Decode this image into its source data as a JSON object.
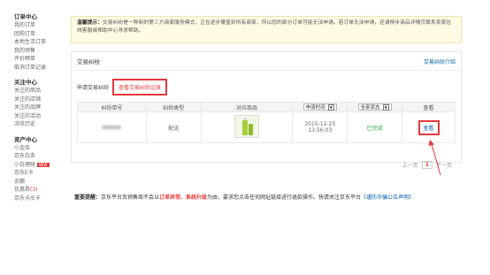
{
  "sidebar": {
    "groups": [
      {
        "title": "订单中心",
        "items": [
          {
            "label": "我的订单"
          },
          {
            "label": "团购订单"
          },
          {
            "label": "本地生活订单"
          },
          {
            "label": "我的预售"
          },
          {
            "label": "评价晒单"
          },
          {
            "label": "取消订单记录"
          }
        ]
      },
      {
        "title": "关注中心",
        "items": [
          {
            "label": "关注的商品"
          },
          {
            "label": "关注的店铺"
          },
          {
            "label": "关注的品牌"
          },
          {
            "label": "关注的活动"
          },
          {
            "label": "浏览历史"
          }
        ]
      },
      {
        "title": "资产中心",
        "items": [
          {
            "label": "小金库"
          },
          {
            "label": "京东白条"
          },
          {
            "label": "小白理财",
            "badge": "NEW"
          },
          {
            "label": "京东E卡"
          },
          {
            "label": "余额"
          },
          {
            "label": "优惠券",
            "count": "(3)"
          },
          {
            "label": "京东卡/E卡"
          }
        ]
      }
    ]
  },
  "notice": {
    "label": "温馨提示：",
    "text": "交易纠纷是一种新的第三方商家服务模式，正在逐步覆盖到所有商家，所以您的部分订单可能无法申请。若订单无法申请，还请移步商品详情页联系卖家在线客服或帮助中心寻求帮助。"
  },
  "panel": {
    "title": "交易纠纷",
    "intro_link": "交易纠纷介绍",
    "tab_apply": "申请交易纠纷",
    "tab_records": "查看交易纠纷记录"
  },
  "table": {
    "headers": [
      "纠纷单号",
      "纠纷类型",
      "对应商品"
    ],
    "time_filter": "申请时间",
    "status_filter": "全部状态",
    "view_header": "查看",
    "rows": [
      {
        "type": "配送",
        "date": "2015-12-15",
        "time": "13:56:03",
        "status": "已完成",
        "action": "查看"
      }
    ]
  },
  "pager": {
    "prev": "上一页",
    "current": "1",
    "next": "下一页"
  },
  "important": {
    "label": "重要提醒：",
    "pre": "京东平台及销售商不会以",
    "red1": "订单异常、系统升级",
    "mid": "为由，要求您点击任何网址链接进行退款操作。快请关注京东平台",
    "link": "《谨防诈骗公告声明》"
  },
  "colors": {
    "accent": "#e4393c",
    "link": "#005ea7",
    "success": "#2aa34a",
    "notice_bg": "#fffbe5"
  }
}
